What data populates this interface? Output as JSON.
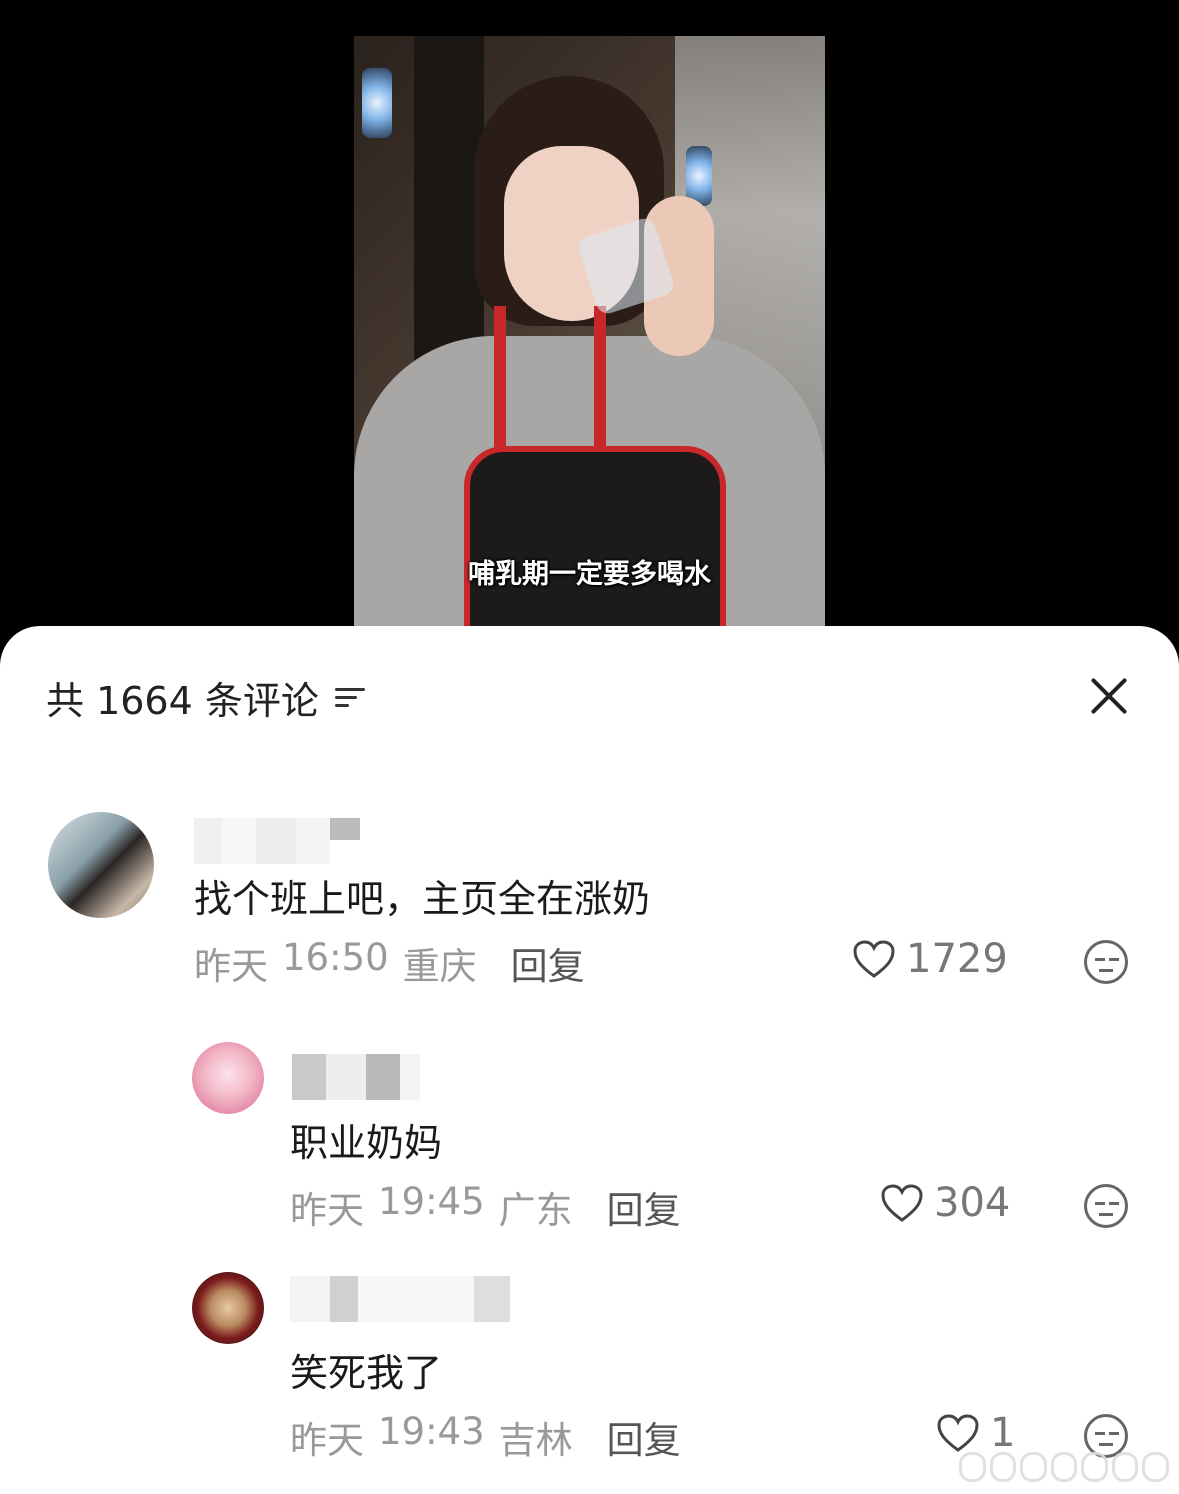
{
  "video": {
    "caption": "哺乳期一定要多喝水"
  },
  "header": {
    "title": "共 1664 条评论"
  },
  "comments": [
    {
      "text": "找个班上吧，主页全在涨奶",
      "date": "昨天",
      "time": "16:50",
      "location": "重庆",
      "reply_label": "回复",
      "likes": "1729"
    },
    {
      "text": "职业奶妈",
      "date": "昨天",
      "time": "19:45",
      "location": "广东",
      "reply_label": "回复",
      "likes": "304"
    },
    {
      "text": "笑死我了",
      "date": "昨天",
      "time": "19:43",
      "location": "吉林",
      "reply_label": "回复",
      "likes": "1"
    }
  ]
}
